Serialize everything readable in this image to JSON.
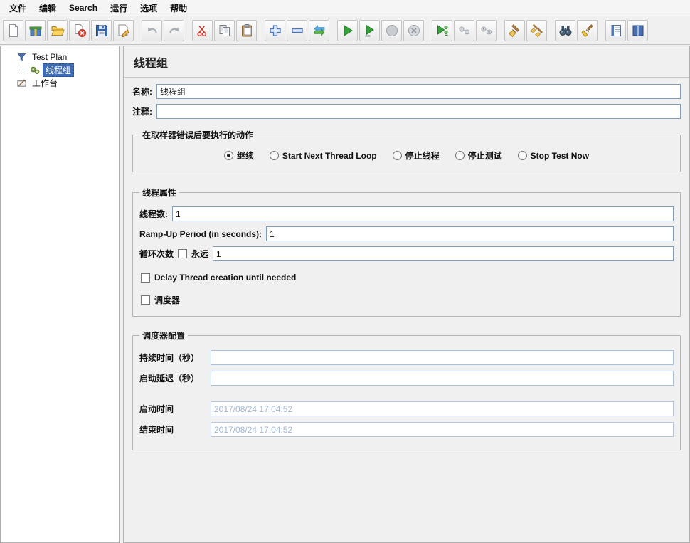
{
  "colors": {
    "selection_bg": "#3d6cb4",
    "accent_green": "#36a33a",
    "disabled_text": "#a4b7d3"
  },
  "menu": {
    "items": [
      "文件",
      "编辑",
      "Search",
      "运行",
      "选项",
      "帮助"
    ]
  },
  "toolbar": {
    "icons": [
      "new-file",
      "templates",
      "open-file",
      "close-file",
      "save",
      "save-as",
      "undo",
      "redo",
      "cut",
      "copy",
      "paste",
      "zoom-in",
      "zoom-out",
      "toggle",
      "start",
      "start-no-pauses",
      "stop",
      "shutdown",
      "remote-start-all",
      "remote-stop-all",
      "remote-shutdown-all",
      "clear",
      "clear-all",
      "search",
      "search-reset",
      "function-helper",
      "help"
    ]
  },
  "tree": {
    "nodes": [
      {
        "label": "Test Plan"
      },
      {
        "label": "线程组",
        "selected": true
      },
      {
        "label": "工作台"
      }
    ]
  },
  "main": {
    "title": "线程组",
    "fields": {
      "name_label": "名称:",
      "name_value": "线程组",
      "comments_label": "注释:",
      "comments_value": ""
    },
    "error_action": {
      "title": "在取样器错误后要执行的动作",
      "options": [
        "继续",
        "Start Next Thread Loop",
        "停止线程",
        "停止测试",
        "Stop Test Now"
      ],
      "selected_index": 0
    },
    "thread_properties": {
      "title": "线程属性",
      "threads_label": "线程数:",
      "threads_value": "1",
      "rampup_label": "Ramp-Up Period (in seconds):",
      "rampup_value": "1",
      "loop_label": "循环次数",
      "forever_label": "永远",
      "forever_checked": false,
      "loop_value": "1",
      "delay_creation_label": "Delay Thread creation until needed",
      "delay_creation_checked": false,
      "scheduler_label": "调度器",
      "scheduler_checked": false
    },
    "scheduler_config": {
      "title": "调度器配置",
      "duration_label": "持续时间（秒）",
      "duration_value": "",
      "startup_delay_label": "启动延迟（秒）",
      "startup_delay_value": "",
      "start_time_label": "启动时间",
      "start_time_value": "2017/08/24 17:04:52",
      "end_time_label": "结束时间",
      "end_time_value": "2017/08/24 17:04:52"
    }
  }
}
